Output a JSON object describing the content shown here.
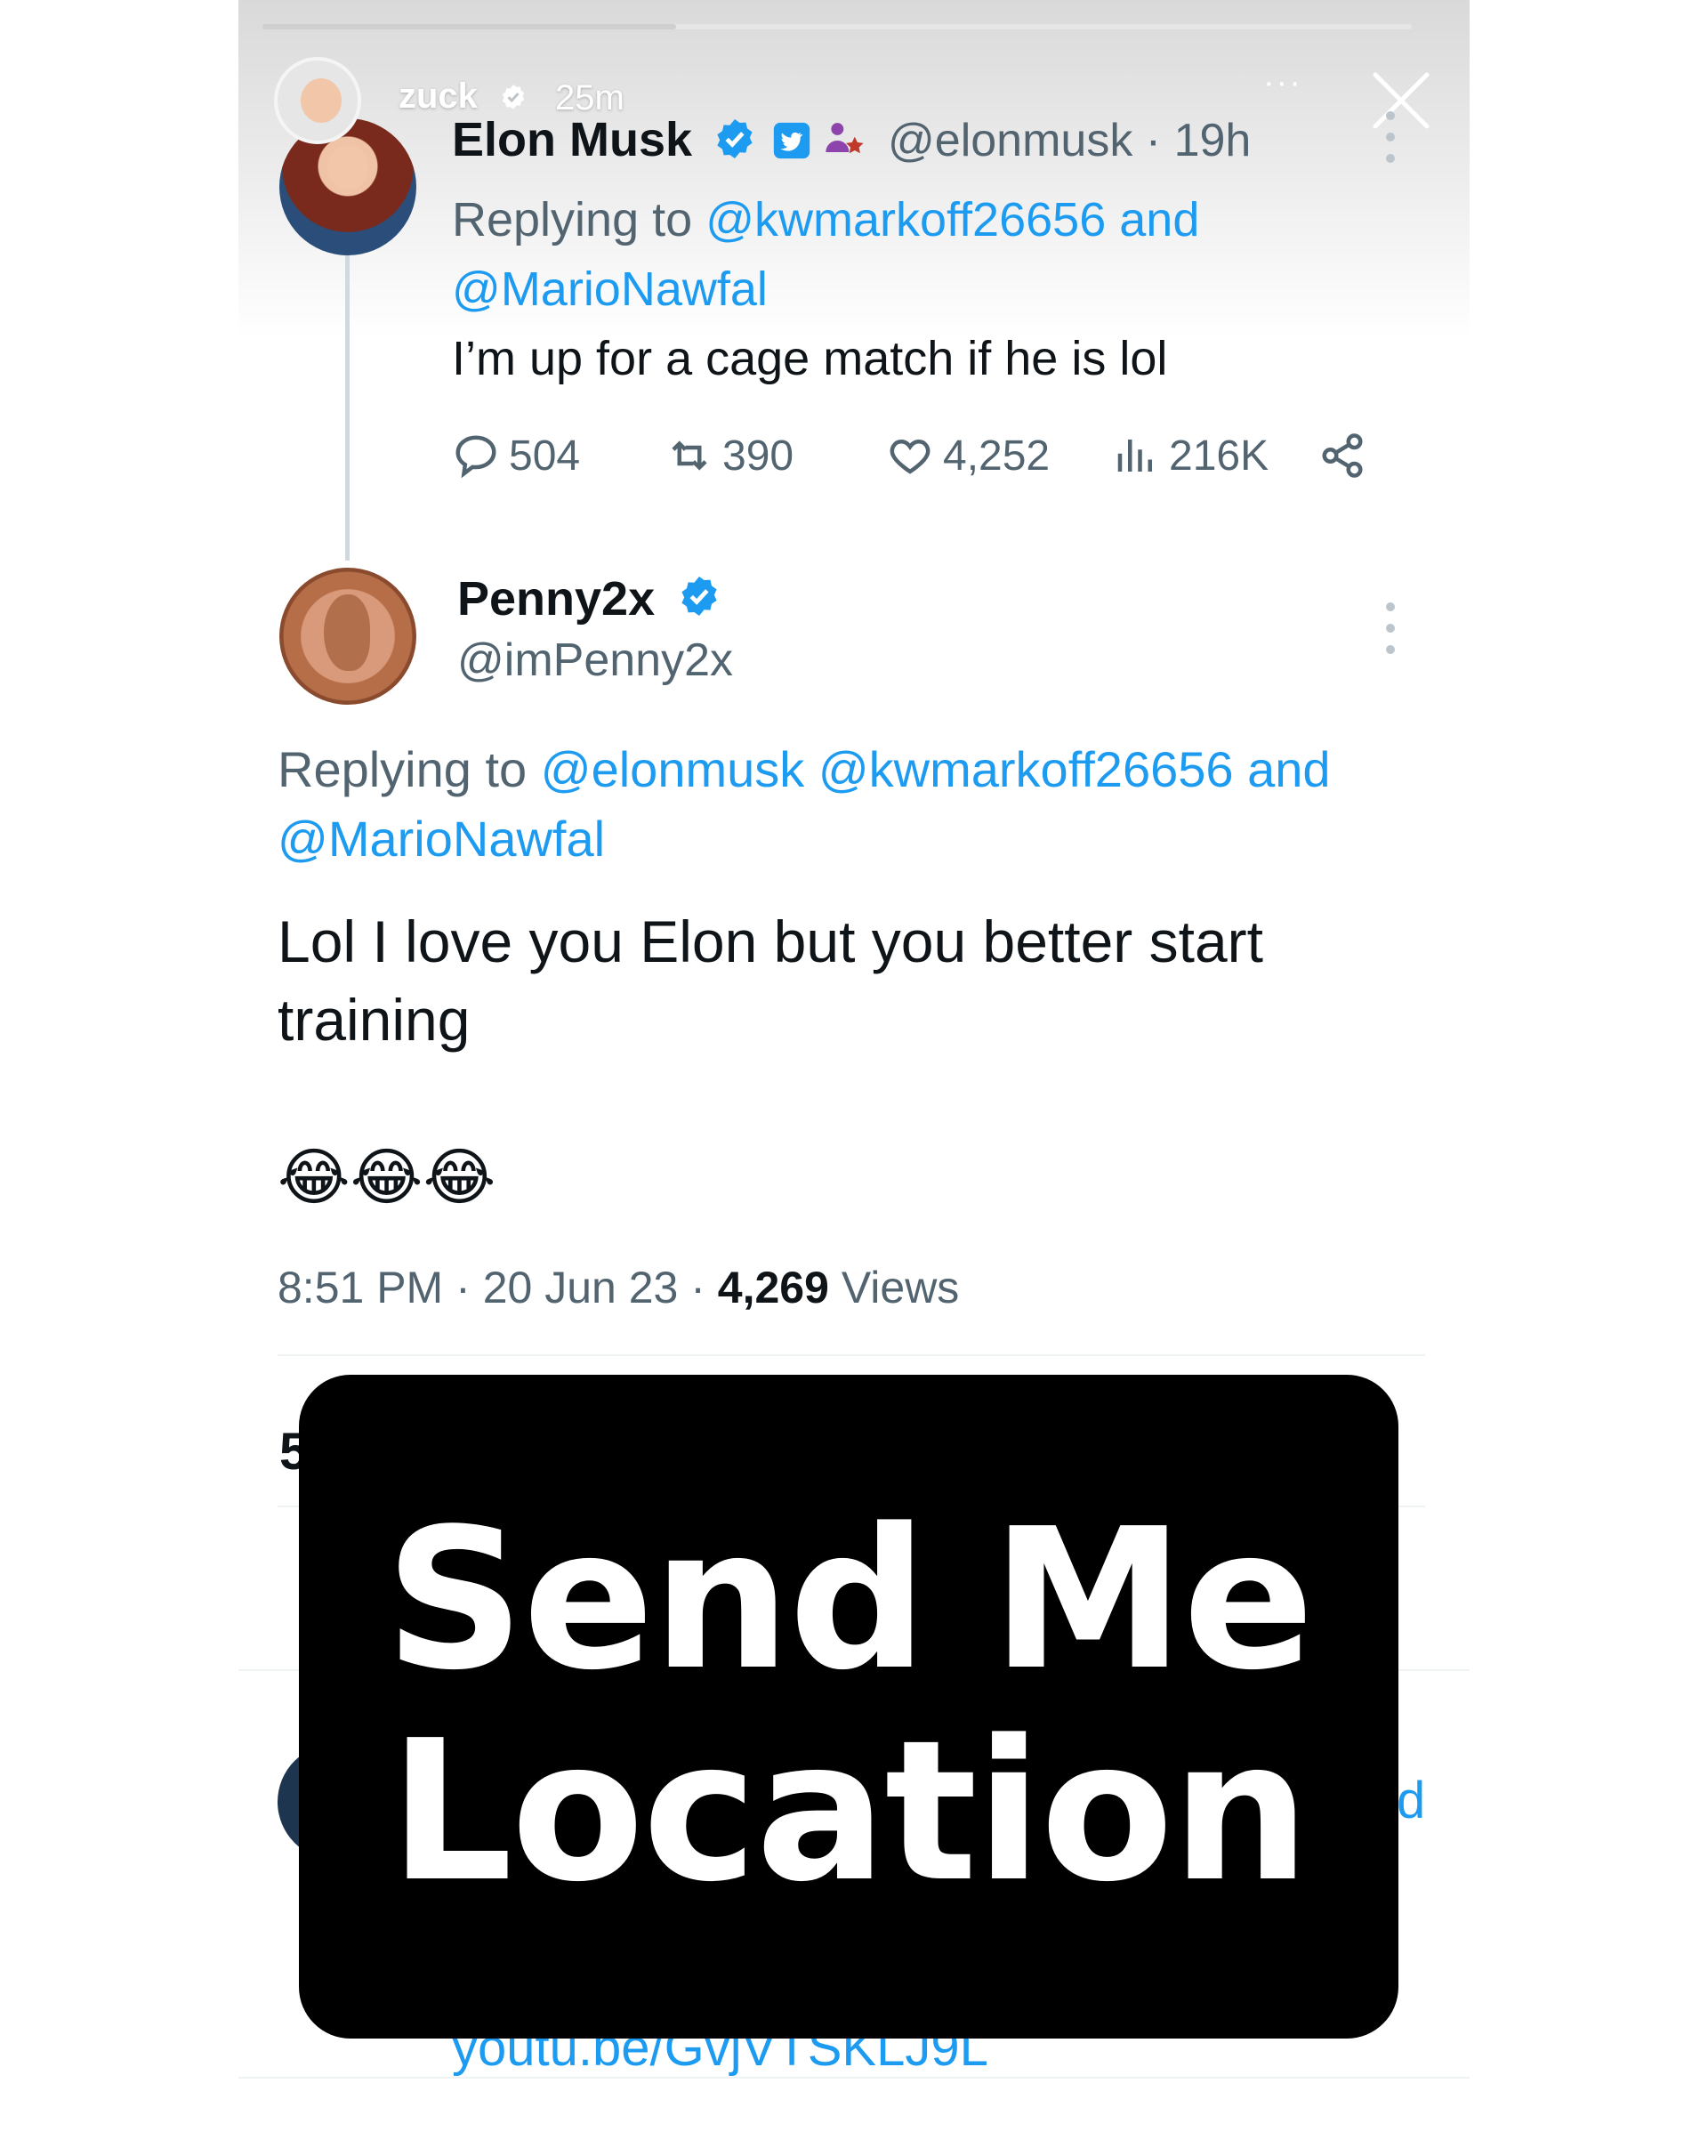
{
  "story": {
    "progress": 0.36,
    "username": "zuck",
    "time": "25m",
    "more_label": "···",
    "close_label": "close"
  },
  "elon_tweet": {
    "display_name": "Elon Musk",
    "handle": "@elonmusk",
    "time_separator": "·",
    "time": "19h",
    "replying_prefix": "Replying to",
    "reply_mention_1": "@kwmarkoff26656",
    "reply_and": "and",
    "reply_mention_2": "@MarioNawfal",
    "text": "I’m up for a cage match if he is lol",
    "replies": "504",
    "retweets": "390",
    "likes": "4,252",
    "views": "216K"
  },
  "penny_tweet": {
    "display_name": "Penny2x",
    "handle": "@imPenny2x",
    "replying_prefix": "Replying to",
    "reply_mention_1": "@elonmusk",
    "reply_mention_2": "@kwmarkoff26656",
    "reply_and": "and",
    "reply_mention_3": "@MarioNawfal",
    "text_line_1": "Lol I love you Elon but you better start",
    "text_line_2": "training",
    "emoji": "😂😂😂",
    "time": "8:51 PM",
    "date": "20 Jun 23",
    "views_count": "4,269",
    "views_label": "Views",
    "meta_separator": "·"
  },
  "obscured": {
    "stat_digit": "5",
    "side_letter": "d",
    "link_text": "youtu.be/GvjVTSKLJ9L"
  },
  "caption": {
    "line_1": "Send Me",
    "line_2": "Location"
  },
  "colors": {
    "accent_blue": "#1d9bf0",
    "muted_text": "#536471",
    "caption_bg": "#000000",
    "caption_text": "#ffffff"
  },
  "icons": [
    "verified-badge-icon",
    "twitter-square-icon",
    "affiliation-icon",
    "reply-icon",
    "retweet-icon",
    "like-icon",
    "views-icon",
    "share-icon",
    "more-vertical-icon",
    "close-icon"
  ]
}
